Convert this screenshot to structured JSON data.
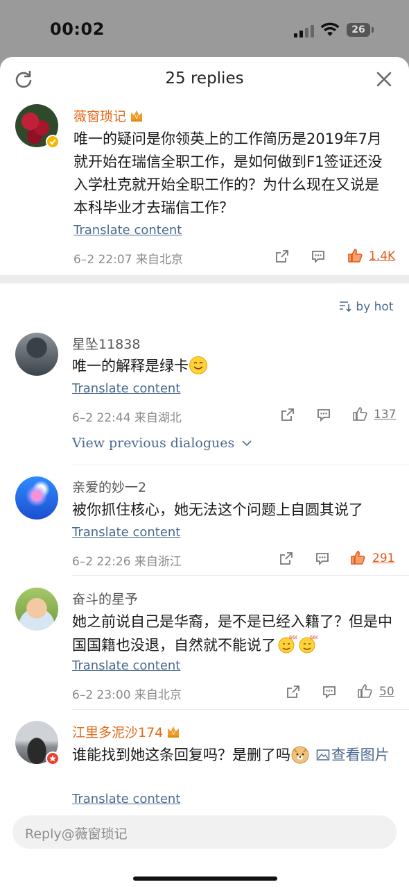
{
  "status": {
    "time": "00:02",
    "battery": "26"
  },
  "header": {
    "title": "25 replies"
  },
  "main_comment": {
    "author": "薇窗琐记",
    "text": "唯一的疑问是你领英上的工作简历是2019年7月就开始在瑞信全职工作，是如何做到F1签证还没入学杜克就开始全职工作的？为什么现在又说是本科毕业才去瑞信工作？",
    "translate": "Translate content",
    "meta": "6–2 22:07 来自北京",
    "likes": "1.4K"
  },
  "sort_label": "by hot",
  "replies": [
    {
      "author": "星坠11838",
      "text": "唯一的解释是绿卡",
      "translate": "Translate content",
      "meta": "6–2 22:44 来自湖北",
      "likes": "137",
      "view_prev": "View previous dialogues"
    },
    {
      "author": "亲爱的妙一2",
      "text": "被你抓住核心，她无法这个问题上自圆其说了",
      "translate": "Translate content",
      "meta": "6–2 22:26 来自浙江",
      "likes": "291"
    },
    {
      "author": "奋斗的星予",
      "text": "她之前说自己是华裔，是不是已经入籍了？但是中国国籍也没退，自然就不能说了",
      "translate": "Translate content",
      "meta": "6–2 23:00 来自北京",
      "likes": "50"
    },
    {
      "author": "江里多泥沙174",
      "text": "谁能找到她这条回复吗？是删了吗",
      "image_link": "查看图片",
      "translate": "Translate content"
    }
  ],
  "reply_input": {
    "placeholder": "Reply@薇窗琐记"
  },
  "colors": {
    "accent_orange": "#e36a1a",
    "link_blue": "#4a6a8f",
    "like_hot": "#e35b1f"
  },
  "icons": [
    "refresh-icon",
    "close-icon",
    "share-icon",
    "comment-icon",
    "like-icon",
    "verified-badge-icon",
    "crown-icon",
    "sort-icon",
    "chevron-down-icon",
    "image-icon"
  ]
}
